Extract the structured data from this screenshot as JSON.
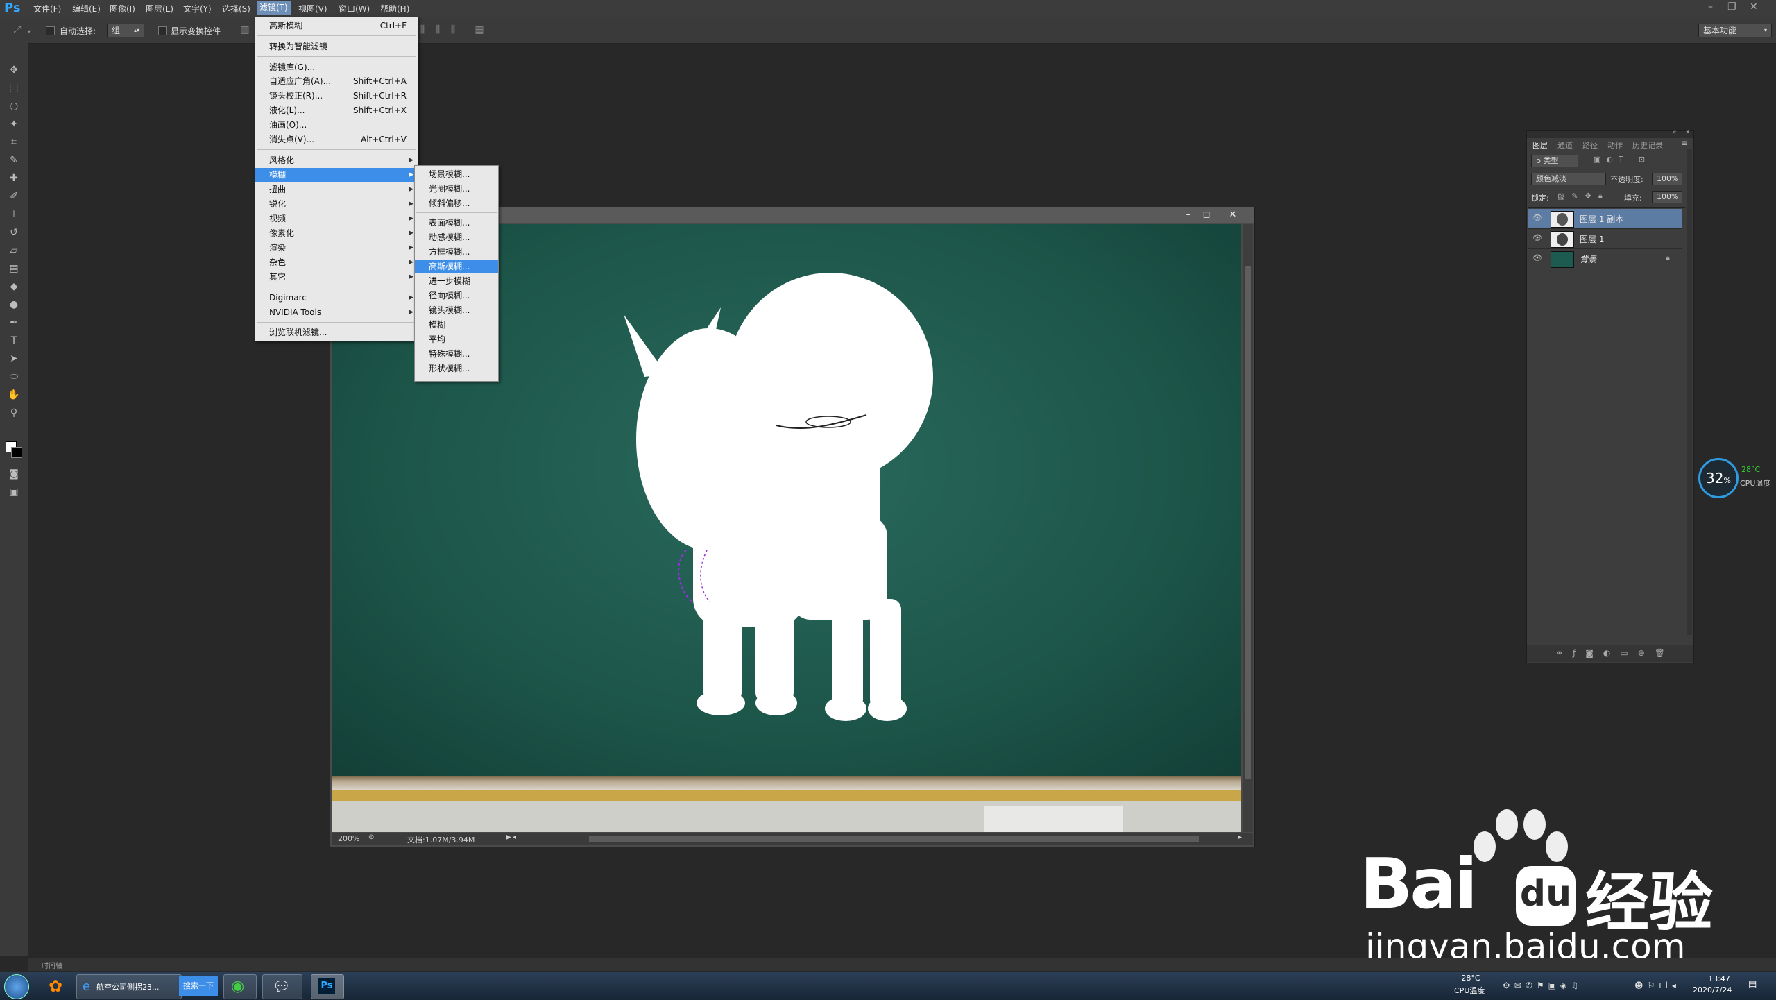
{
  "app": {
    "name": "Ps"
  },
  "menubar": {
    "items": [
      "文件(F)",
      "编辑(E)",
      "图像(I)",
      "图层(L)",
      "文字(Y)",
      "选择(S)",
      "滤镜(T)",
      "视图(V)",
      "窗口(W)",
      "帮助(H)"
    ],
    "active_index": 6
  },
  "options": {
    "auto_select_label": "自动选择:",
    "auto_select_value": "组",
    "show_transform_label": "显示变换控件",
    "workspace": "基本功能"
  },
  "filter_menu": {
    "last_filter": {
      "label": "高斯模糊",
      "shortcut": "Ctrl+F"
    },
    "smart": "转换为智能滤镜",
    "group1": [
      {
        "label": "滤镜库(G)...",
        "shortcut": ""
      },
      {
        "label": "自适应广角(A)...",
        "shortcut": "Shift+Ctrl+A"
      },
      {
        "label": "镜头校正(R)...",
        "shortcut": "Shift+Ctrl+R"
      },
      {
        "label": "液化(L)...",
        "shortcut": "Shift+Ctrl+X"
      },
      {
        "label": "油画(O)...",
        "shortcut": ""
      },
      {
        "label": "消失点(V)...",
        "shortcut": "Alt+Ctrl+V"
      }
    ],
    "group2": [
      "风格化",
      "模糊",
      "扭曲",
      "锐化",
      "视频",
      "像素化",
      "渲染",
      "杂色",
      "其它"
    ],
    "group3": [
      "Digimarc",
      "NVIDIA Tools"
    ],
    "browse": "浏览联机滤镜..."
  },
  "blur_submenu": {
    "group1": [
      "场景模糊...",
      "光圈模糊...",
      "倾斜偏移..."
    ],
    "group2": [
      "表面模糊...",
      "动感模糊...",
      "方框模糊...",
      "高斯模糊...",
      "进一步模糊",
      "径向模糊...",
      "镜头模糊...",
      "模糊",
      "平均",
      "特殊模糊...",
      "形状模糊..."
    ],
    "highlighted": "高斯模糊..."
  },
  "document": {
    "zoom": "200%",
    "doc_size": "文档:1.07M/3.94M"
  },
  "layers_panel": {
    "tabs": [
      "图层",
      "通道",
      "路径",
      "动作",
      "历史记录"
    ],
    "kind_label": "ρ 类型",
    "blend_mode": "颜色减淡",
    "opacity_label": "不透明度:",
    "opacity": "100%",
    "lock_label": "锁定:",
    "fill_label": "填充:",
    "fill": "100%",
    "layers": [
      {
        "name": "图层 1 副本",
        "selected": true
      },
      {
        "name": "图层 1",
        "selected": false
      },
      {
        "name": "背景",
        "selected": false,
        "locked": true
      }
    ]
  },
  "cpu_widget": {
    "percent": "32",
    "unit": "%",
    "temp": "28°C",
    "label": "CPU温度"
  },
  "timeline": {
    "label": "时间轴"
  },
  "watermark": {
    "brand": "Bai",
    "brand2": "du",
    "suffix": "经验",
    "url": "jingyan.baidu.com"
  },
  "taskbar": {
    "ie_label": "航空公司侧拐23...",
    "search_label": "搜索一下",
    "temp": "28°C",
    "temp_label": "CPU温度",
    "time": "13:47",
    "date": "2020/7/24"
  },
  "colors": {
    "accent": "#3d8ee8",
    "chalkboard": "#1d5a4f",
    "panel": "#3d3d3d"
  }
}
